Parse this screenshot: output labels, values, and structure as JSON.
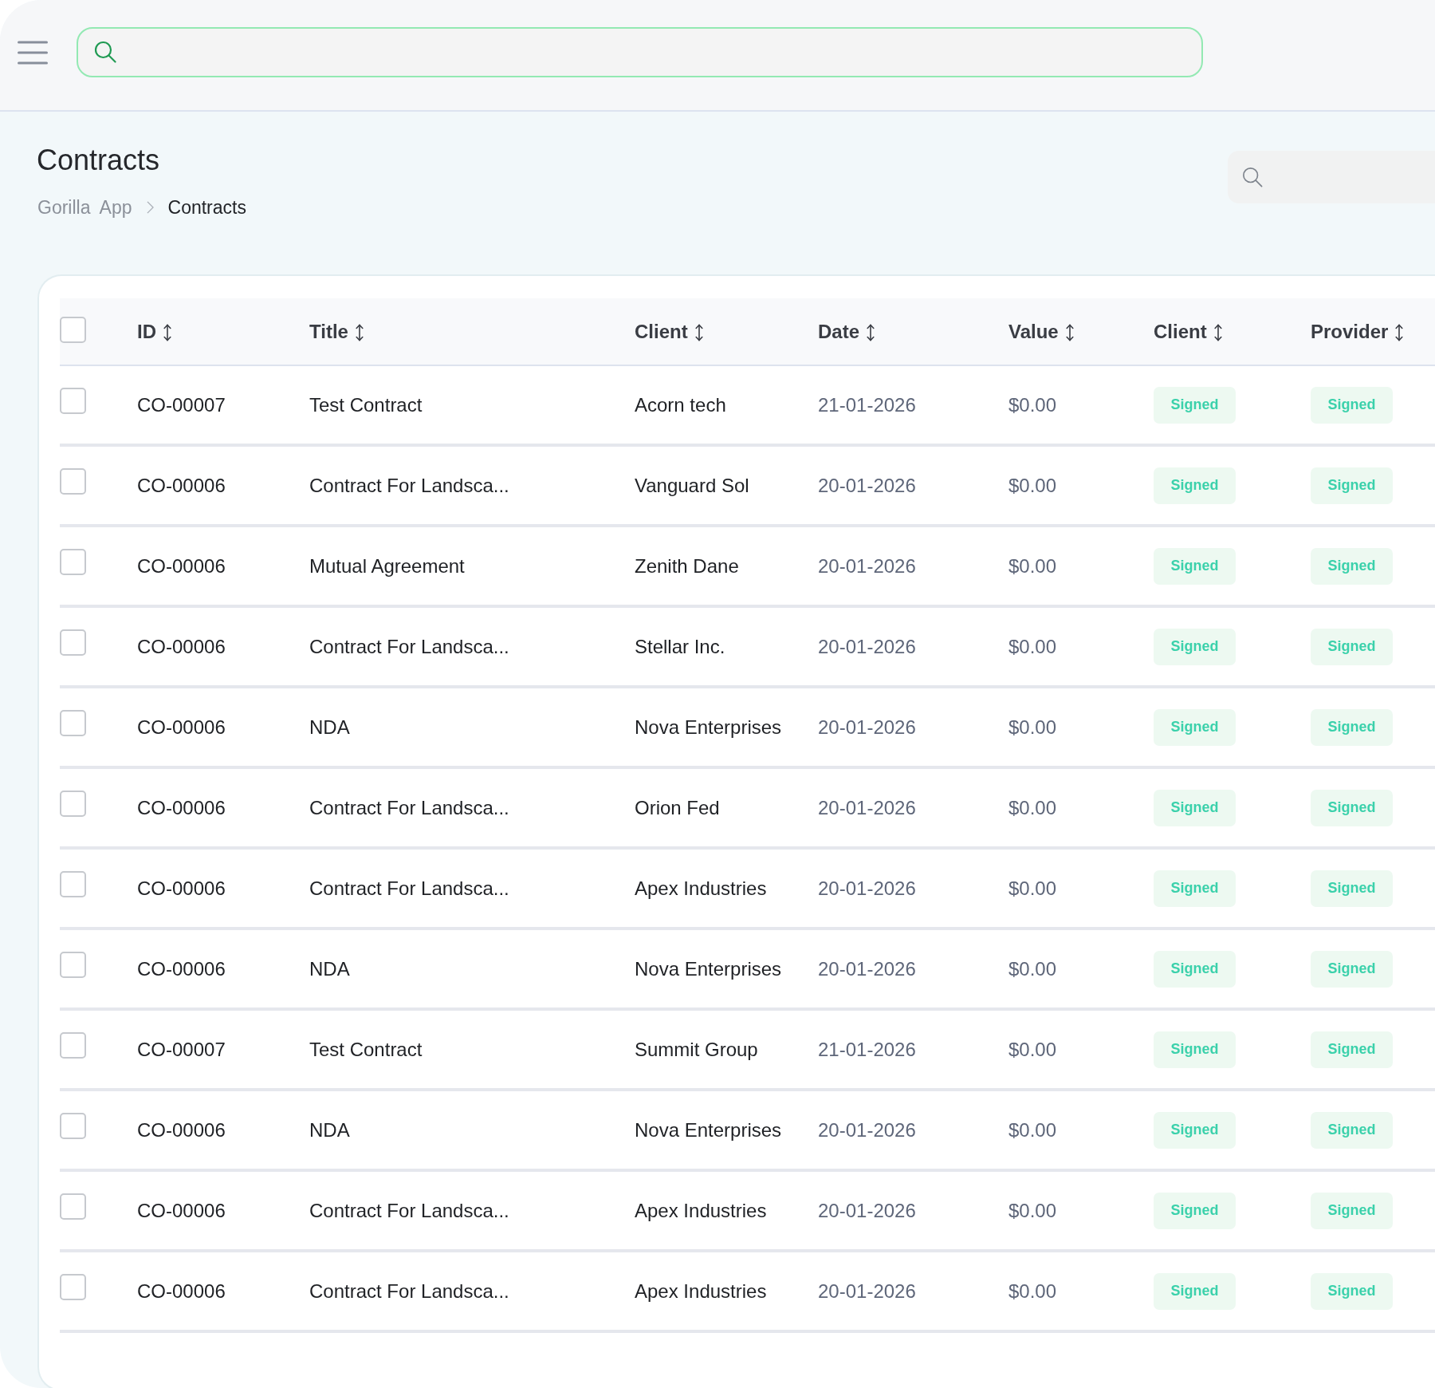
{
  "page": {
    "title": "Contracts",
    "breadcrumb": [
      {
        "label": "Gorilla App",
        "current": false
      },
      {
        "label": "Contracts",
        "current": true
      }
    ]
  },
  "table": {
    "select_all": {
      "checked": false
    },
    "columns": [
      {
        "label": "ID",
        "sortable": true
      },
      {
        "label": "Title",
        "sortable": true
      },
      {
        "label": "Client",
        "sortable": true
      },
      {
        "label": "Date",
        "sortable": true
      },
      {
        "label": "Value",
        "sortable": true
      },
      {
        "label": "Client",
        "sortable": true
      },
      {
        "label": "Provider",
        "sortable": true
      }
    ],
    "rows": [
      {
        "checked": false,
        "id": "CO-00007",
        "title": "Test Contract",
        "client": "Acorn tech",
        "date": "21-01-2026",
        "value": "$0.00",
        "client_status": "Signed",
        "provider_status": "Signed"
      },
      {
        "checked": false,
        "id": "CO-00006",
        "title": "Contract For Landsca...",
        "client": "Vanguard Sol",
        "date": "20-01-2026",
        "value": "$0.00",
        "client_status": "Signed",
        "provider_status": "Signed"
      },
      {
        "checked": false,
        "id": "CO-00006",
        "title": "Mutual Agreement",
        "client": "Zenith Dane",
        "date": "20-01-2026",
        "value": "$0.00",
        "client_status": "Signed",
        "provider_status": "Signed"
      },
      {
        "checked": false,
        "id": "CO-00006",
        "title": "Contract For Landsca...",
        "client": "Stellar Inc.",
        "date": "20-01-2026",
        "value": "$0.00",
        "client_status": "Signed",
        "provider_status": "Signed"
      },
      {
        "checked": false,
        "id": "CO-00006",
        "title": "NDA",
        "client": "Nova Enterprises",
        "date": "20-01-2026",
        "value": "$0.00",
        "client_status": "Signed",
        "provider_status": "Signed"
      },
      {
        "checked": false,
        "id": "CO-00006",
        "title": "Contract For Landsca...",
        "client": "Orion Fed",
        "date": "20-01-2026",
        "value": "$0.00",
        "client_status": "Signed",
        "provider_status": "Signed"
      },
      {
        "checked": false,
        "id": "CO-00006",
        "title": "Contract For Landsca...",
        "client": "Apex Industries",
        "date": "20-01-2026",
        "value": "$0.00",
        "client_status": "Signed",
        "provider_status": "Signed"
      },
      {
        "checked": false,
        "id": "CO-00006",
        "title": "NDA",
        "client": "Nova Enterprises",
        "date": "20-01-2026",
        "value": "$0.00",
        "client_status": "Signed",
        "provider_status": "Signed"
      },
      {
        "checked": false,
        "id": "CO-00007",
        "title": "Test Contract",
        "client": "Summit Group",
        "date": "21-01-2026",
        "value": "$0.00",
        "client_status": "Signed",
        "provider_status": "Signed"
      },
      {
        "checked": false,
        "id": "CO-00006",
        "title": "NDA",
        "client": "Nova Enterprises",
        "date": "20-01-2026",
        "value": "$0.00",
        "client_status": "Signed",
        "provider_status": "Signed"
      },
      {
        "checked": false,
        "id": "CO-00006",
        "title": "Contract For Landsca...",
        "client": "Apex Industries",
        "date": "20-01-2026",
        "value": "$0.00",
        "client_status": "Signed",
        "provider_status": "Signed"
      },
      {
        "checked": false,
        "id": "CO-00006",
        "title": "Contract For Landsca...",
        "client": "Apex Industries",
        "date": "20-01-2026",
        "value": "$0.00",
        "client_status": "Signed",
        "provider_status": "Signed"
      }
    ]
  }
}
